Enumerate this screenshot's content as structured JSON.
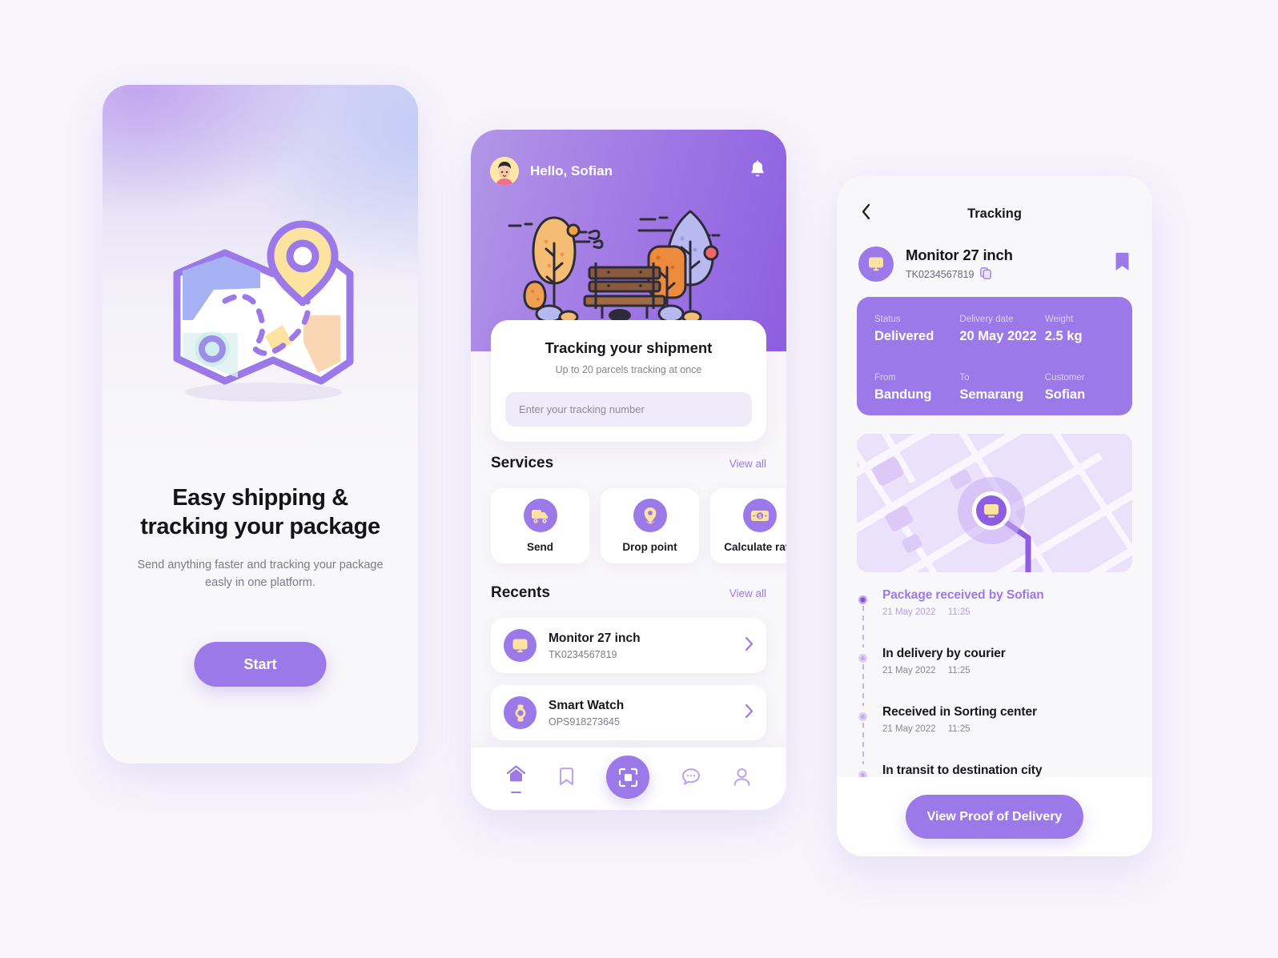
{
  "theme": {
    "page_bg": "#f7f4fd",
    "primary": "#9b79e8",
    "primary_dark": "#8d5ee1",
    "accent_yellow": "#fde3a0",
    "text_dark": "#18171d",
    "text_muted": "#7f7c89"
  },
  "onboarding": {
    "illustration": "map-pin-illustration",
    "title": "Easy shipping &\ntracking your package",
    "title_line1": "Easy shipping &",
    "title_line2": "tracking your package",
    "subtitle": "Send anything faster and tracking your package easly in one platform.",
    "start_label": "Start"
  },
  "home": {
    "greeting": "Hello, Sofian",
    "avatar": "user-avatar",
    "notification_icon": "bell-icon",
    "hero_illustration": "park-bench-trees-illustration",
    "search_card": {
      "title": "Tracking your shipment",
      "subtitle": "Up to 20 parcels tracking at once",
      "input_placeholder": "Enter your tracking number",
      "input_value": ""
    },
    "services": {
      "title": "Services",
      "view_all": "View all",
      "items": [
        {
          "label": "Send",
          "icon": "truck-icon"
        },
        {
          "label": "Drop point",
          "icon": "map-pin-icon"
        },
        {
          "label": "Calculate rate",
          "icon": "money-icon"
        }
      ]
    },
    "recents": {
      "title": "Recents",
      "view_all": "View all",
      "items": [
        {
          "name": "Monitor 27 inch",
          "code": "TK0234567819",
          "icon": "monitor-icon"
        },
        {
          "name": "Smart Watch",
          "code": "OPS918273645",
          "icon": "watch-icon"
        }
      ]
    },
    "tabbar": [
      {
        "name": "home",
        "icon": "home-icon",
        "active": true
      },
      {
        "name": "saved",
        "icon": "bookmark-icon",
        "active": false
      },
      {
        "name": "scan",
        "icon": "scan-icon",
        "active": false
      },
      {
        "name": "chat",
        "icon": "chat-icon",
        "active": false
      },
      {
        "name": "profile",
        "icon": "person-icon",
        "active": false
      }
    ]
  },
  "tracking": {
    "nav_title": "Tracking",
    "back_icon": "chevron-left-icon",
    "bookmark_icon": "bookmark-filled-icon",
    "copy_icon": "copy-icon",
    "item": {
      "name": "Monitor 27 inch",
      "code": "TK0234567819",
      "icon": "monitor-icon"
    },
    "info": [
      {
        "label": "Status",
        "value": "Delivered"
      },
      {
        "label": "Delivery date",
        "value": "20 May 2022"
      },
      {
        "label": "Weight",
        "value": "2.5 kg"
      },
      {
        "label": "From",
        "value": "Bandung"
      },
      {
        "label": "To",
        "value": "Semarang"
      },
      {
        "label": "Customer",
        "value": "Sofian"
      }
    ],
    "map": {
      "marker_icon": "monitor-icon",
      "label": "delivery-route-map"
    },
    "timeline": [
      {
        "title": "Package received by Sofian",
        "date": "21 May 2022",
        "time": "11:25",
        "active": true
      },
      {
        "title": "In delivery by courier",
        "date": "21 May 2022",
        "time": "11:25",
        "active": false
      },
      {
        "title": "Received in Sorting center",
        "date": "21 May 2022",
        "time": "11:25",
        "active": false
      },
      {
        "title": "In transit to destination city",
        "date": "",
        "time": "",
        "active": false
      }
    ],
    "cta_label": "View Proof of Delivery"
  }
}
